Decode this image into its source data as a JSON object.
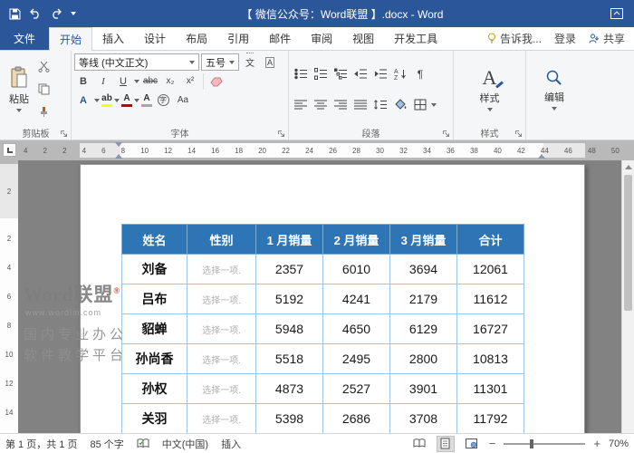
{
  "titlebar": {
    "title": "【 微信公众号：Word联盟 】.docx - Word"
  },
  "tabs": {
    "file": "文件",
    "items": [
      "开始",
      "插入",
      "设计",
      "布局",
      "引用",
      "邮件",
      "审阅",
      "视图",
      "开发工具"
    ],
    "active": "开始",
    "tell_me": "告诉我...",
    "sign_in": "登录",
    "share": "共享"
  },
  "ribbon": {
    "paste": "粘贴",
    "font_name": "等线 (中文正文)",
    "font_size": "五号",
    "styles_button": "样式",
    "editing_button": "编辑",
    "group_labels": {
      "clipboard": "剪贴板",
      "font": "字体",
      "paragraph": "段落",
      "styles": "样式"
    }
  },
  "ruler": {
    "h_numbers": [
      "4",
      "2",
      "2",
      "4",
      "6",
      "8",
      "10",
      "12",
      "14",
      "16",
      "18",
      "20",
      "22",
      "24",
      "26",
      "28",
      "30",
      "32",
      "34",
      "36",
      "38",
      "40",
      "42",
      "44",
      "46",
      "48",
      "50"
    ],
    "v_numbers": [
      "2",
      "2",
      "4",
      "6",
      "8",
      "10",
      "12",
      "14"
    ]
  },
  "document": {
    "table": {
      "headers": [
        "姓名",
        "性别",
        "1 月销量",
        "2 月销量",
        "3 月销量",
        "合计"
      ],
      "rows": [
        [
          "刘备",
          "选择一项.",
          "2357",
          "6010",
          "3694",
          "12061"
        ],
        [
          "吕布",
          "选择一项.",
          "5192",
          "4241",
          "2179",
          "11612"
        ],
        [
          "貂蝉",
          "选择一项.",
          "5948",
          "4650",
          "6129",
          "16727"
        ],
        [
          "孙尚香",
          "选择一项.",
          "5518",
          "2495",
          "2800",
          "10813"
        ],
        [
          "孙权",
          "选择一项.",
          "4873",
          "2527",
          "3901",
          "11301"
        ],
        [
          "关羽",
          "选择一项.",
          "5398",
          "2686",
          "3708",
          "11792"
        ]
      ]
    },
    "watermark": {
      "brand": "Word联盟",
      "reg": "®",
      "url": "www.wordlm.com",
      "tagline1": "国内专业办公",
      "tagline2": "软件教学平台"
    }
  },
  "statusbar": {
    "page_info": "第 1 页，共 1 页",
    "word_count": "85 个字",
    "language": "中文(中国)",
    "insert_mode": "插入",
    "zoom": "70%"
  },
  "colors": {
    "titlebar": "#2b579a",
    "table_header": "#2e75b6",
    "table_border": "#9dc3e6",
    "doc_background": "#828282"
  }
}
